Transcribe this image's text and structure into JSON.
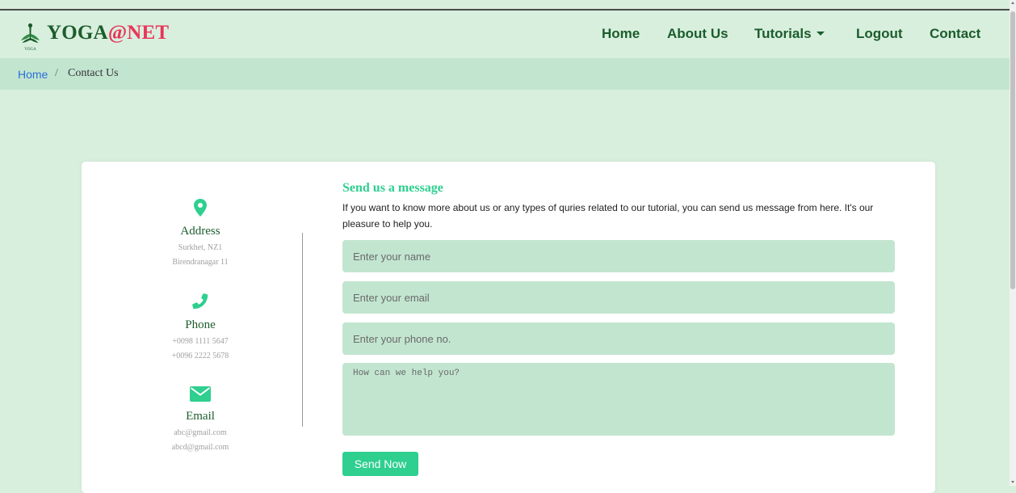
{
  "colors": {
    "brand_green": "#1c5c2b",
    "accent": "#2ecf8f",
    "accent_red": "#e8365a",
    "link_blue": "#2a6fd6",
    "page_bg": "#d8efde",
    "field_bg": "#c2e5d0"
  },
  "logo": {
    "text_main": "YOGA",
    "text_at": "@NET",
    "icon_caption": "YOGA",
    "icon": "yoga-pose-icon"
  },
  "nav": {
    "home": "Home",
    "about": "About Us",
    "tutorials": "Tutorials",
    "logout": "Logout",
    "contact": "Contact"
  },
  "breadcrumb": {
    "home": "Home",
    "separator": "/",
    "current": "Contact Us"
  },
  "contact_info": {
    "address": {
      "icon": "map-pin-icon",
      "title": "Address",
      "lines": [
        "Surkhet, NZ1",
        "Birendranagar 11"
      ]
    },
    "phone": {
      "icon": "phone-icon",
      "title": "Phone",
      "lines": [
        "+0098 1111 5647",
        "+0096 2222 5678"
      ]
    },
    "email": {
      "icon": "envelope-icon",
      "title": "Email",
      "lines": [
        "abc@gmail.com",
        "abcd@gmail.com"
      ]
    }
  },
  "form": {
    "title": "Send us a message",
    "description": "If you want to know more about us or any types of quries related to our tutorial, you can send us message from here. It's our pleasure to help you.",
    "name_placeholder": "Enter your name",
    "email_placeholder": "Enter your email",
    "phone_placeholder": "Enter your phone no.",
    "message_placeholder": "How can we help you?",
    "submit_label": "Send Now"
  }
}
